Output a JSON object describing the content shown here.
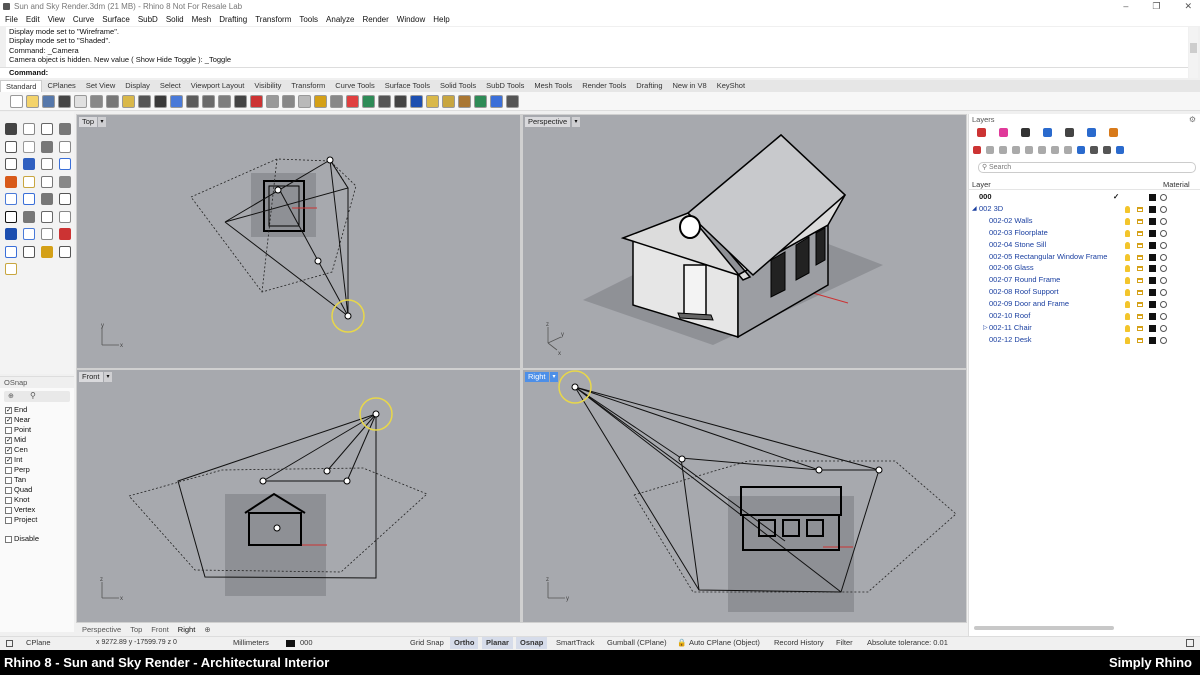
{
  "window": {
    "title": "Sun and Sky Render.3dm (21 MB) - Rhino 8 Not For Resale Lab",
    "controls": [
      "–",
      "❐",
      "✕"
    ]
  },
  "menu": [
    "File",
    "Edit",
    "View",
    "Curve",
    "Surface",
    "SubD",
    "Solid",
    "Mesh",
    "Drafting",
    "Transform",
    "Tools",
    "Analyze",
    "Render",
    "Window",
    "Help"
  ],
  "command_history": [
    "Display mode set to \"Wireframe\".",
    "Display mode set to \"Shaded\".",
    "Command: _Camera",
    "Camera object is hidden. New value ( Show  Hide  Toggle ): _Toggle"
  ],
  "command_prompt": "Command:",
  "toolbar_tabs": [
    "Standard",
    "CPlanes",
    "Set View",
    "Display",
    "Select",
    "Viewport Layout",
    "Visibility",
    "Transform",
    "Curve Tools",
    "Surface Tools",
    "Solid Tools",
    "SubD Tools",
    "Mesh Tools",
    "Render Tools",
    "Drafting",
    "New in V8",
    "KeyShot"
  ],
  "osnap": {
    "title": "OSnap",
    "items": [
      {
        "label": "End",
        "checked": true
      },
      {
        "label": "Near",
        "checked": true
      },
      {
        "label": "Point",
        "checked": false
      },
      {
        "label": "Mid",
        "checked": true
      },
      {
        "label": "Cen",
        "checked": true
      },
      {
        "label": "Int",
        "checked": true
      },
      {
        "label": "Perp",
        "checked": false
      },
      {
        "label": "Tan",
        "checked": false
      },
      {
        "label": "Quad",
        "checked": false
      },
      {
        "label": "Knot",
        "checked": false
      },
      {
        "label": "Vertex",
        "checked": false
      },
      {
        "label": "Project",
        "checked": false
      }
    ],
    "disable_label": "Disable"
  },
  "viewports": {
    "top": {
      "label": "Top"
    },
    "perspective": {
      "label": "Perspective"
    },
    "front": {
      "label": "Front"
    },
    "right": {
      "label": "Right"
    },
    "axis_x": "x",
    "axis_y": "y",
    "axis_z": "z"
  },
  "viewport_tabs": [
    "Perspective",
    "Top",
    "Front",
    "Right"
  ],
  "layers": {
    "panel_title": "Layers",
    "search_placeholder": "Search",
    "col_layer": "Layer",
    "col_material": "Material",
    "rows": [
      {
        "name": "000",
        "bold": true,
        "current": true,
        "indent": 0
      },
      {
        "name": "002 3D",
        "bold": false,
        "current": false,
        "indent": 1,
        "expanded": true
      },
      {
        "name": "002-02 Walls",
        "indent": 2
      },
      {
        "name": "002-03 Floorplate",
        "indent": 2
      },
      {
        "name": "002-04 Stone Sill",
        "indent": 2
      },
      {
        "name": "002-05 Rectangular Window Frame",
        "indent": 2
      },
      {
        "name": "002-06 Glass",
        "indent": 2
      },
      {
        "name": "002-07 Round Frame",
        "indent": 2
      },
      {
        "name": "002-08 Roof Support",
        "indent": 2
      },
      {
        "name": "002-09 Door and Frame",
        "indent": 2
      },
      {
        "name": "002-10 Roof",
        "indent": 2
      },
      {
        "name": "002-11 Chair",
        "indent": 2,
        "collapsed": true
      },
      {
        "name": "002-12 Desk",
        "indent": 2
      }
    ]
  },
  "status": {
    "cplane": "CPlane",
    "coords": "x 9272.89  y -17599.79  z 0",
    "units": "Millimeters",
    "layer": "000",
    "grid_snap": "Grid Snap",
    "ortho": "Ortho",
    "planar": "Planar",
    "osnap": "Osnap",
    "smarttrack": "SmartTrack",
    "gumball": "Gumball (CPlane)",
    "auto_cplane": "Auto CPlane (Object)",
    "record_history": "Record History",
    "filter": "Filter",
    "tolerance": "Absolute tolerance: 0.01"
  },
  "caption": {
    "left": "Rhino 8 - Sun and Sky Render - Architectural Interior",
    "right": "Simply Rhino"
  }
}
